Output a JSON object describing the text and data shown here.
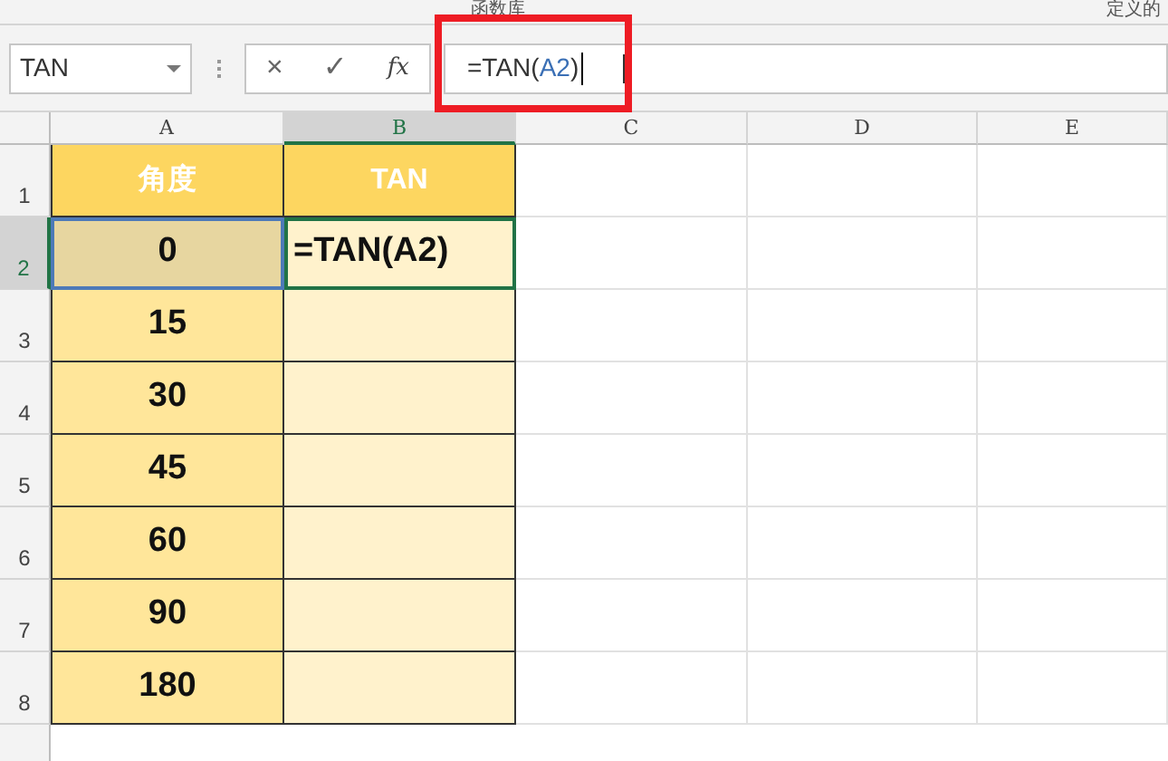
{
  "ribbon": {
    "groups": [
      "函数库",
      "定义的"
    ]
  },
  "name_box": {
    "value": "TAN"
  },
  "formula_bar": {
    "buttons": [
      "×",
      "✓",
      "fx"
    ],
    "parts": [
      {
        "text": "=TAN(",
        "kind": "plain"
      },
      {
        "text": "A2",
        "kind": "reference"
      },
      {
        "text": ")",
        "kind": "plain"
      }
    ]
  },
  "columns": [
    {
      "label": "A",
      "selected": false
    },
    {
      "label": "B",
      "selected": true
    },
    {
      "label": "C",
      "selected": false
    },
    {
      "label": "D",
      "selected": false
    },
    {
      "label": "E",
      "selected": false
    }
  ],
  "rows": [
    {
      "number": "1",
      "selected": false,
      "kind": "header",
      "cells": [
        {
          "text": "角度"
        },
        {
          "text": "TAN"
        }
      ]
    },
    {
      "number": "2",
      "selected": true,
      "kind": "data",
      "cells": [
        {
          "text": "0",
          "referenced": true
        },
        {
          "text": "=TAN(A2)",
          "active": true
        }
      ]
    },
    {
      "number": "3",
      "selected": false,
      "kind": "data",
      "cells": [
        {
          "text": "15"
        },
        {}
      ]
    },
    {
      "number": "4",
      "selected": false,
      "kind": "data",
      "cells": [
        {
          "text": "30"
        },
        {}
      ]
    },
    {
      "number": "5",
      "selected": false,
      "kind": "data",
      "cells": [
        {
          "text": "45"
        },
        {}
      ]
    },
    {
      "number": "6",
      "selected": false,
      "kind": "data",
      "cells": [
        {
          "text": "60"
        },
        {}
      ]
    },
    {
      "number": "7",
      "selected": false,
      "kind": "data",
      "cells": [
        {
          "text": "90"
        },
        {}
      ]
    },
    {
      "number": "8",
      "selected": false,
      "kind": "data",
      "cells": [
        {
          "text": "180"
        },
        {}
      ]
    }
  ]
}
